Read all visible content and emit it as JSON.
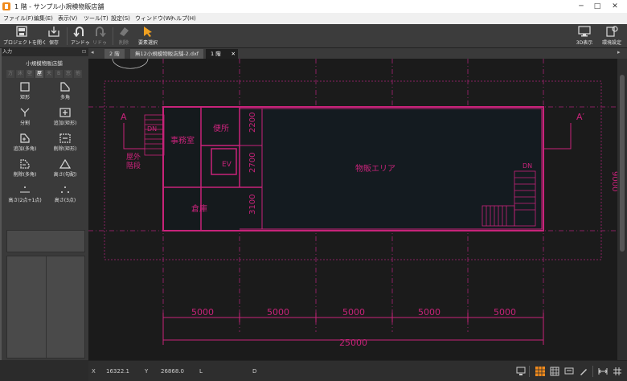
{
  "window": {
    "title": "1 階 - サンプル小規模物販店舗"
  },
  "menu": [
    "ファイル(F)",
    "編集(E)",
    "表示(V)",
    "ツール(T)",
    "設定(S)",
    "ウィンドウ(W)",
    "ヘルプ(H)"
  ],
  "toolbar": {
    "open_project": "プロジェクトを開く",
    "save": "保存",
    "undo": "アンドゥ",
    "redo": "リドゥ",
    "delete": "削除",
    "select": "要素選択",
    "view3d": "3D表示",
    "env_settings": "環境設定"
  },
  "panel": {
    "header": "入力",
    "project_name": "小規模物販店舗",
    "subtabs": [
      "方",
      "床",
      "壁",
      "屋",
      "天",
      "B",
      "窓",
      "他"
    ],
    "tools": [
      "矩形",
      "多角",
      "分割",
      "追加(矩形)",
      "追加(多角)",
      "削除(矩形)",
      "削除(多角)",
      "高さ(勾配)",
      "高さ(2点+1点)",
      "高さ(3点)"
    ]
  },
  "tabs": [
    "2 階",
    "無12小規模物販店舗-2.dxf",
    "1 階"
  ],
  "drawing": {
    "room_office": "事務室",
    "room_toilet": "便所",
    "room_ev": "EV",
    "room_storage": "倉庫",
    "room_sales": "物販エリア",
    "stairs_outer": "屋外\n階段",
    "dn_left": "DN",
    "dn_right": "DN",
    "section_a_left": "A",
    "section_a_right": "A′",
    "dim_vertical": [
      "2200",
      "2700",
      "3100"
    ],
    "dim_spans": [
      "5000",
      "5000",
      "5000",
      "5000",
      "5000"
    ],
    "dim_total": "25000",
    "dim_right_partial": "9000"
  },
  "status": {
    "x_label": "X",
    "x_value": "16322.1",
    "y_label": "Y",
    "y_value": "26868.0",
    "l_label": "L",
    "d_label": "D"
  },
  "colors": {
    "accent_line": "#c8237a",
    "toolbar_bg": "#3c3c3c",
    "canvas_bg": "#1b1b1b",
    "status_active": "#f08a1c"
  }
}
